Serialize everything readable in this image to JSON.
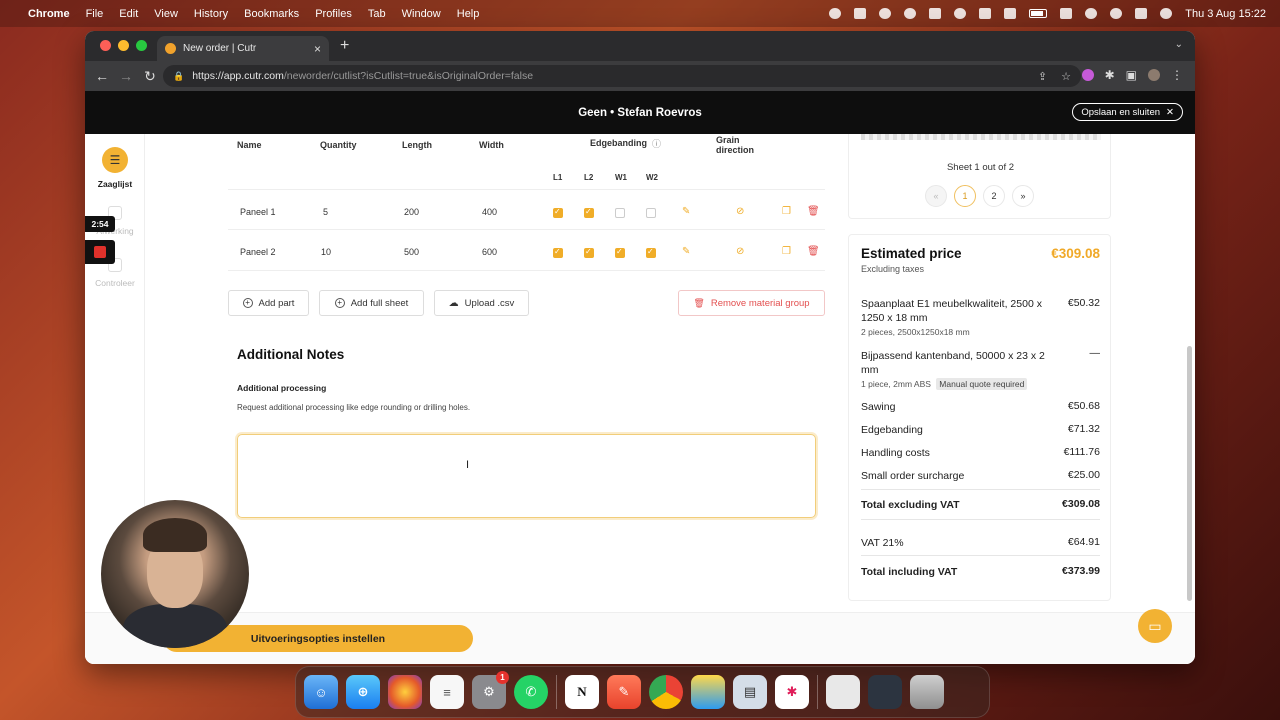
{
  "menubar": {
    "app": "Chrome",
    "items": [
      "File",
      "Edit",
      "View",
      "History",
      "Bookmarks",
      "Profiles",
      "Tab",
      "Window",
      "Help"
    ],
    "clock": "Thu 3 Aug  15:22"
  },
  "browser": {
    "tab_title": "New order | Cutr",
    "url_host": "https://app.cutr.com",
    "url_path": "/neworder/cutlist?isCutlist=true&isOriginalOrder=false"
  },
  "header": {
    "title": "Geen • Stefan Roevros",
    "save_close": "Opslaan en sluiten"
  },
  "sidebar": {
    "items": [
      {
        "label": "Zaaglijst"
      },
      {
        "label": "Afwerking"
      },
      {
        "label": "Controleer"
      }
    ],
    "timer": "2:54"
  },
  "table": {
    "headers": {
      "name": "Name",
      "quantity": "Quantity",
      "length": "Length",
      "width": "Width",
      "edgebanding": "Edgebanding",
      "grain": "Grain direction"
    },
    "edge_cols": [
      "L1",
      "L2",
      "W1",
      "W2"
    ],
    "rows": [
      {
        "name": "Paneel 1",
        "quantity": "5",
        "length": "200",
        "width": "400",
        "edges": [
          true,
          true,
          false,
          false
        ]
      },
      {
        "name": "Paneel 2",
        "quantity": "10",
        "length": "500",
        "width": "600",
        "edges": [
          true,
          true,
          true,
          true
        ]
      }
    ]
  },
  "actions": {
    "add_part": "Add part",
    "add_full_sheet": "Add full sheet",
    "upload_csv": "Upload .csv",
    "remove_group": "Remove material group"
  },
  "notes": {
    "title": "Additional Notes",
    "subtitle": "Additional processing",
    "description": "Request additional processing like edge rounding or drilling holes.",
    "value": ""
  },
  "footer": {
    "primary": "Uitvoeringsopties instellen"
  },
  "sheet": {
    "label": "Sheet 1 out of 2",
    "pages": [
      "«",
      "1",
      "2",
      "»"
    ]
  },
  "price": {
    "title": "Estimated price",
    "subtitle": "Excluding taxes",
    "total": "€309.08",
    "lines": [
      {
        "label": "Spaanplaat E1 meubelkwaliteit, 2500 x 1250 x 18 mm",
        "value": "€50.32",
        "detail": "2 pieces, 2500x1250x18 mm"
      },
      {
        "label": "Bijpassend kantenband, 50000 x 23 x 2 mm",
        "value": "—",
        "detail": "1 piece, 2mm ABS",
        "badge": "Manual quote required"
      },
      {
        "label": "Sawing",
        "value": "€50.68"
      },
      {
        "label": "Edgebanding",
        "value": "€71.32"
      },
      {
        "label": "Handling costs",
        "value": "€111.76"
      },
      {
        "label": "Small order surcharge",
        "value": "€25.00"
      }
    ],
    "total_excl_label": "Total excluding VAT",
    "total_excl": "€309.08",
    "vat_label": "VAT 21%",
    "vat": "€64.91",
    "total_incl_label": "Total including VAT",
    "total_incl": "€373.99"
  },
  "dock": {
    "badge_count": "1"
  },
  "colors": {
    "accent": "#f2b233",
    "danger": "#e35050"
  }
}
